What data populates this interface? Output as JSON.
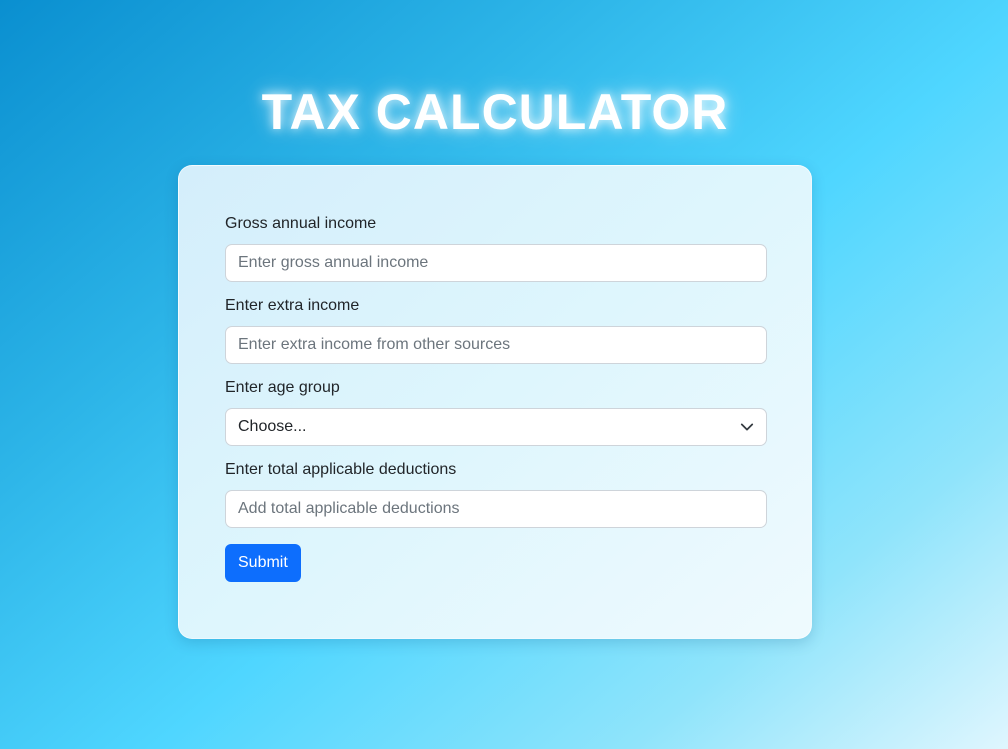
{
  "page": {
    "title": "TAX CALCULATOR"
  },
  "form": {
    "gross_income": {
      "label": "Gross annual income",
      "placeholder": "Enter gross annual income"
    },
    "extra_income": {
      "label": "Enter extra income",
      "placeholder": "Enter extra income from other sources"
    },
    "age_group": {
      "label": "Enter age group",
      "selected": "Choose..."
    },
    "deductions": {
      "label": "Enter total applicable deductions",
      "placeholder": "Add total applicable deductions"
    },
    "submit_label": "Submit"
  },
  "colors": {
    "primary_button": "#0d6efd",
    "title_text": "#ffffff"
  },
  "icons": {
    "select_indicator": "chevron-down-icon"
  }
}
